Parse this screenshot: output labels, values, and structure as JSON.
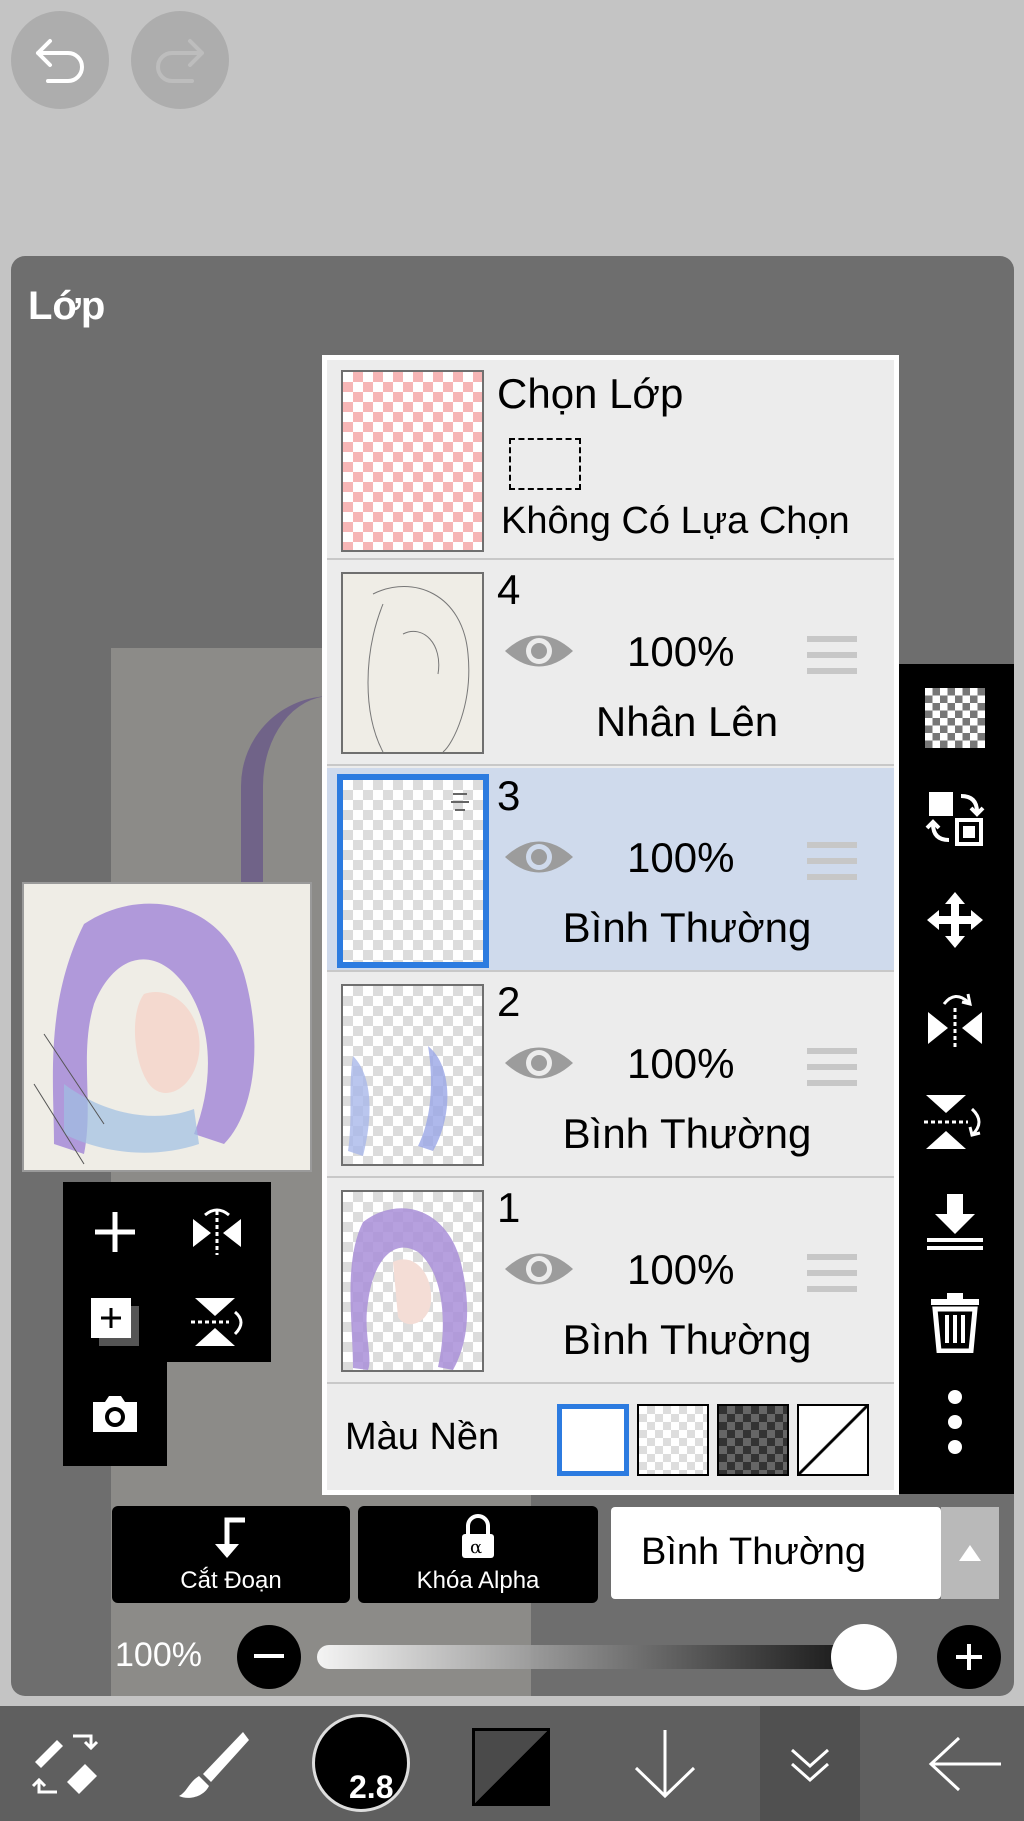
{
  "panel": {
    "title": "Lớp"
  },
  "selection_layer": {
    "title": "Chọn Lớp",
    "status": "Không Có Lựa Chọn"
  },
  "layers": [
    {
      "number": "4",
      "opacity": "100%",
      "blend_mode": "Nhân Lên",
      "visible": true,
      "selected": false
    },
    {
      "number": "3",
      "opacity": "100%",
      "blend_mode": "Bình Thường",
      "visible": true,
      "selected": true
    },
    {
      "number": "2",
      "opacity": "100%",
      "blend_mode": "Bình Thường",
      "visible": true,
      "selected": false
    },
    {
      "number": "1",
      "opacity": "100%",
      "blend_mode": "Bình Thường",
      "visible": true,
      "selected": false
    }
  ],
  "background": {
    "label": "Màu Nền",
    "options": [
      "white",
      "transparent",
      "dark-check",
      "none"
    ],
    "selected": "white"
  },
  "actions": {
    "clip_label": "Cắt Đoạn",
    "alpha_lock_label": "Khóa Alpha"
  },
  "blend_select": {
    "value": "Bình Thường"
  },
  "opacity_control": {
    "label": "100%",
    "value": 1.0
  },
  "brush": {
    "size": "2.8"
  },
  "colors": {
    "accent": "#2c7be0",
    "selected_row": "#cfdaec",
    "panel": "#6e6e6e"
  }
}
